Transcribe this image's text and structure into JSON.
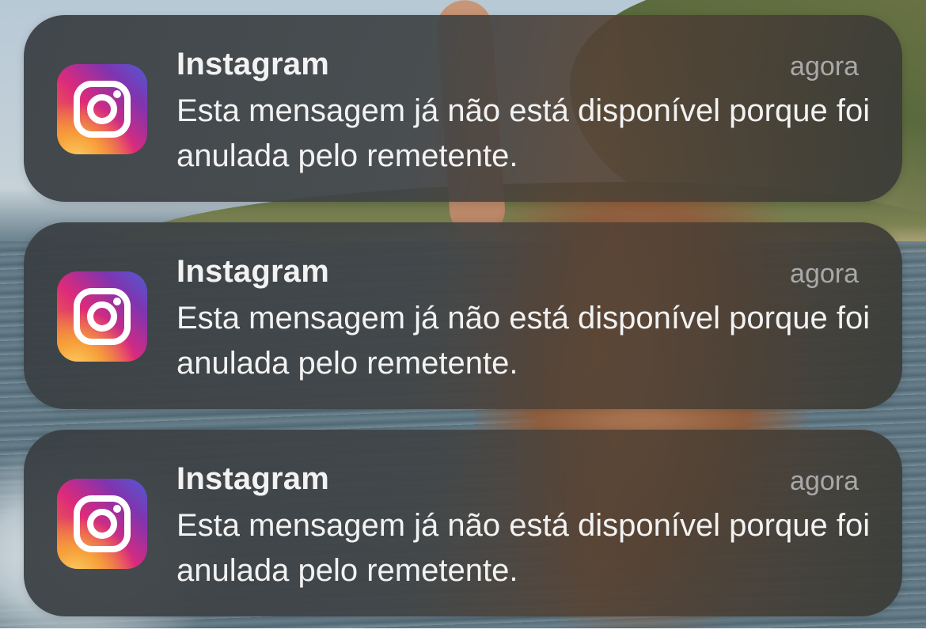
{
  "notifications": [
    {
      "app_name": "Instagram",
      "time": "agora",
      "message": "Esta mensagem já não está disponível porque foi anulada pelo remetente.",
      "icon": "instagram-icon"
    },
    {
      "app_name": "Instagram",
      "time": "agora",
      "message": "Esta mensagem já não está disponível porque foi anulada pelo remetente.",
      "icon": "instagram-icon"
    },
    {
      "app_name": "Instagram",
      "time": "agora",
      "message": "Esta mensagem já não está disponível porque foi anulada pelo remetente.",
      "icon": "instagram-icon"
    }
  ],
  "colors": {
    "instagram_gradient": [
      "#f58529",
      "#dd2a7b",
      "#8134af",
      "#515bd4"
    ],
    "text_primary": "#f2f2f2",
    "text_secondary": "#a9a9a9"
  }
}
